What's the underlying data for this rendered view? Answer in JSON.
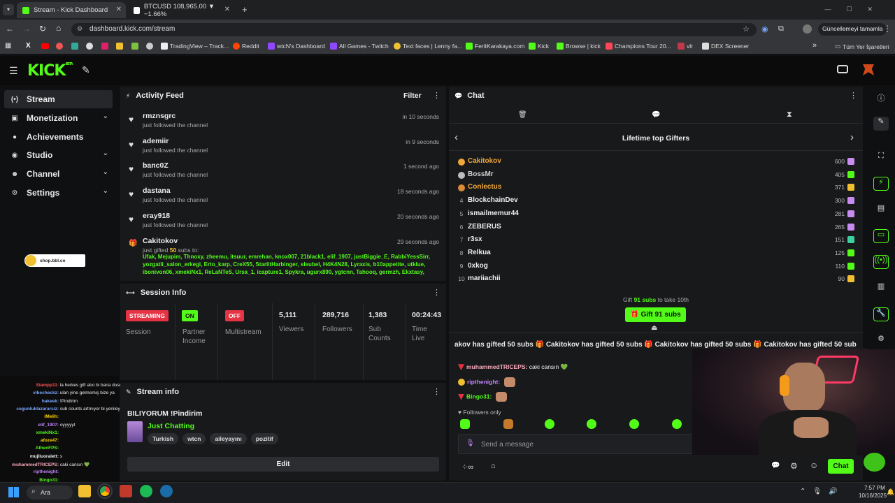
{
  "browser": {
    "tabs": [
      {
        "title": "Stream - Kick Dashboard"
      },
      {
        "title": "BTCUSD 108,965.00 ▼ −1.66%"
      }
    ],
    "new_tab": "+",
    "url": "dashboard.kick.com/stream",
    "update_label": "Güncellemeyi tamamla",
    "bookmarks": [
      "TradingView – Track...",
      "Reddit",
      "wtcN's Dashboard",
      "All Games - Twitch",
      "Text faces | Lenny fa...",
      "FeritKarakaya.com",
      "Kick",
      "Browse | kick",
      "Champions Tour 20...",
      "vlr",
      "DEX Screener"
    ],
    "bookmarks_more": "»",
    "all_bookmarks": "Tüm Yer İşaretleri"
  },
  "kick": {
    "logo": "KICK",
    "logo_sup": "BETA"
  },
  "sidebar": {
    "items": [
      {
        "label": "Stream",
        "has_chevron": false
      },
      {
        "label": "Monetization",
        "has_chevron": true
      },
      {
        "label": "Achievements",
        "has_chevron": false
      },
      {
        "label": "Studio",
        "has_chevron": true
      },
      {
        "label": "Channel",
        "has_chevron": true
      },
      {
        "label": "Settings",
        "has_chevron": true
      }
    ],
    "shop_link": "shop.bbl.co"
  },
  "activity": {
    "title": "Activity Feed",
    "filter": "Filter",
    "items": [
      {
        "name": "rmznsgrc",
        "action": "just followed the channel",
        "time": "in 10 seconds"
      },
      {
        "name": "ademiir",
        "action": "just followed the channel",
        "time": "in 9 seconds"
      },
      {
        "name": "banc0Z",
        "action": "just followed the channel",
        "time": "1 second ago"
      },
      {
        "name": "dastana",
        "action": "just followed the channel",
        "time": "18 seconds ago"
      },
      {
        "name": "eray918",
        "action": "just followed the channel",
        "time": "20 seconds ago"
      }
    ],
    "gift": {
      "name": "Cakitokov",
      "prefix": "just gifted",
      "count": "50",
      "suffix": "subs to:",
      "time": "29 seconds ago",
      "recipients_1": "Ufak, Mejupim, Thnoxy, zheemu, itsuur, emrehan, knox007, 21black1, elif_1907, justBiggie_E, RabbiYessSirr,",
      "recipients_2": "yozgatli_salon_erkegi, Erto_karp, CreX55, StarlitHarbinger, sleubel, H4K4N28, Lyraxis, b10appetite, utklue,",
      "recipients_3": "ibonivon06, xmekiNx1, ReLaNTeS, Ursa_1, icapture1, Spykra, ugurx890, ygtcnn, Tahooq, germzh, Ekxtasy,"
    }
  },
  "session": {
    "title": "Session Info",
    "streaming": "STREAMING",
    "session_label": "Session",
    "on": "ON",
    "partner_label_1": "Partner",
    "partner_label_2": "Income",
    "off": "OFF",
    "multistream_label": "Multistream",
    "viewers": "5,111",
    "viewers_label": "Viewers",
    "followers": "289,716",
    "followers_label": "Followers",
    "subs": "1,383",
    "subs_label_1": "Sub",
    "subs_label_2": "Counts",
    "time": "00:24:43",
    "time_label_1": "Time",
    "time_label_2": "Live"
  },
  "stream_info": {
    "title": "Stream info",
    "stream_title": "BILIYORUM !Pindirim",
    "category": "Just Chatting",
    "tags": [
      "Turkish",
      "wtcn",
      "aileyayını",
      "pozitif"
    ],
    "edit": "Edit"
  },
  "chat": {
    "title": "Chat",
    "gifters_title": "Lifetime top Gifters",
    "gifters": [
      {
        "rank": "",
        "name": "Cakitokov",
        "count": "600",
        "color": "#f0a73a",
        "box": "#c88bf0"
      },
      {
        "rank": "",
        "name": "BossMr",
        "count": "405",
        "color": "#cfcfcf",
        "box": "#53fc18"
      },
      {
        "rank": "",
        "name": "Conlectus",
        "count": "371",
        "color": "#f0a73a",
        "box": "#f0c030"
      },
      {
        "rank": "4",
        "name": "BlockchainDev",
        "count": "300",
        "color": "#eee",
        "box": "#c88bf0"
      },
      {
        "rank": "5",
        "name": "ismailmemur44",
        "count": "281",
        "color": "#eee",
        "box": "#c88bf0"
      },
      {
        "rank": "6",
        "name": "ZEBERUS",
        "count": "265",
        "color": "#eee",
        "box": "#c88bf0"
      },
      {
        "rank": "7",
        "name": "r3sx",
        "count": "151",
        "color": "#eee",
        "box": "#3ad0a0"
      },
      {
        "rank": "8",
        "name": "Relkua",
        "count": "125",
        "color": "#eee",
        "box": "#53fc18"
      },
      {
        "rank": "9",
        "name": "0xkog",
        "count": "110",
        "color": "#eee",
        "box": "#53fc18"
      },
      {
        "rank": "10",
        "name": "mariiachii",
        "count": "90",
        "color": "#eee",
        "box": "#f0c030"
      }
    ],
    "gift_hint_pre": "Gift",
    "gift_hint_num": "91 subs",
    "gift_hint_post": "to take 10th",
    "gift_button": "Gift 91 subs",
    "ticker": "akov has gifted 50 subs 🎁 Cakitokov has gifted 50 subs 🎁 Cakitokov has gifted 50 subs 🎁 Cakitokov has gifted 50 subs 🎁",
    "messages": [
      {
        "user": "muhammedTRICEPS:",
        "text": "caki cansın 💚",
        "color": "#f7a8b8"
      },
      {
        "user": "ripthenight:",
        "text": "",
        "color": "#c084fc"
      },
      {
        "user": "Bingo31:",
        "text": "",
        "color": "#53fc18"
      }
    ],
    "followers_only": "Followers only",
    "input_placeholder": "Send a message",
    "send": "Chat"
  },
  "overlay_chat": [
    {
      "user": "Siampp11:",
      "text": "la herkes gift atıo bi bana dusmedi",
      "color": "#ff5050"
    },
    {
      "user": "vibecheckz:",
      "text": "ulan yine gelmemiş bize ya",
      "color": "#7aa7ff"
    },
    {
      "user": "hakeek:",
      "text": "!Pindirim",
      "color": "#7aa7ff"
    },
    {
      "user": "cogunluklazararsiz:",
      "text": "sub counts artmıyor bi yenileyelim şunu",
      "color": "#7aa7ff"
    },
    {
      "user": "iMelih:",
      "text": "",
      "color": "#ffd700"
    },
    {
      "user": "elif_1907:",
      "text": "oyyyyyt",
      "color": "#c084fc"
    },
    {
      "user": "xmekiNx1:",
      "text": "",
      "color": "#53fc18"
    },
    {
      "user": "afoze47:",
      "text": "",
      "color": "#ffd700"
    },
    {
      "user": "AthenFPS:",
      "text": "",
      "color": "#53fc18"
    },
    {
      "user": "mujlluoralett:",
      "text": "s",
      "color": "#eee"
    },
    {
      "user": "muhammedTRICEPS:",
      "text": "caki cansın 💚",
      "color": "#f7a8b8"
    },
    {
      "user": "ripthenight:",
      "text": "",
      "color": "#c084fc"
    },
    {
      "user": "Bingo31:",
      "text": "",
      "color": "#53fc18"
    }
  ],
  "taskbar": {
    "search": "Ara",
    "time": "7:57 PM",
    "date": "10/16/2025"
  },
  "colors": {
    "kick_green": "#53fc18",
    "streaming_red": "#e53344",
    "bg": "#0f1012",
    "panel": "#18191b"
  }
}
